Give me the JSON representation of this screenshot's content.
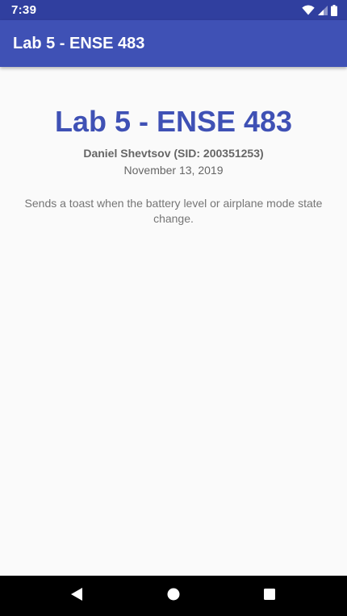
{
  "status_bar": {
    "time": "7:39",
    "icons": [
      "wifi-icon",
      "signal-icon",
      "battery-icon"
    ]
  },
  "app_bar": {
    "title": "Lab 5 - ENSE 483"
  },
  "main": {
    "heading": "Lab 5 - ENSE 483",
    "author": "Daniel Shevtsov (SID: 200351253)",
    "date": "November 13, 2019",
    "description": "Sends a toast when the battery level or airplane mode state change."
  },
  "nav_bar": {
    "buttons": [
      "back-icon",
      "home-icon",
      "recents-icon"
    ]
  },
  "colors": {
    "primary": "#3f51b5",
    "primary_dark": "#303f9f",
    "background": "#fafafa"
  }
}
